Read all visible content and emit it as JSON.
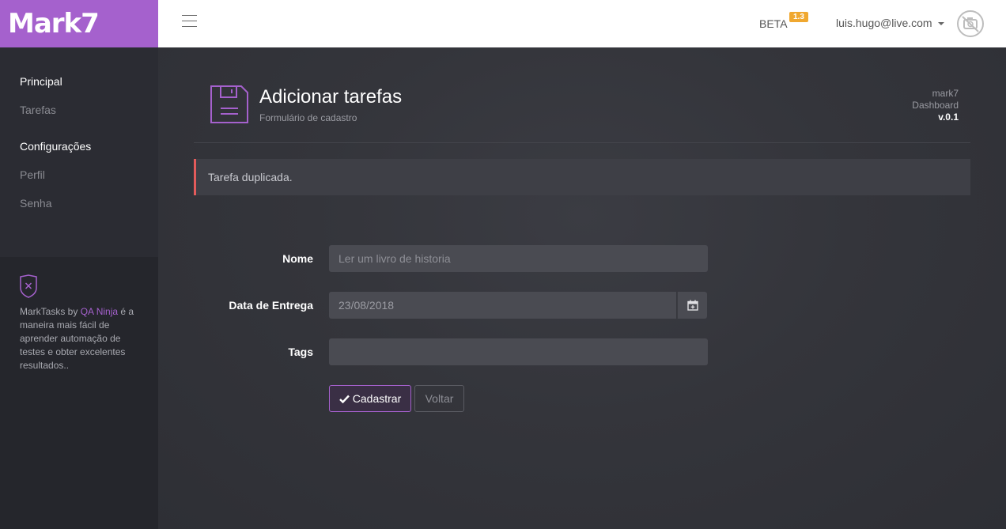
{
  "brand": {
    "name": "Mark7"
  },
  "header": {
    "beta_label": "BETA",
    "beta_version": "1.3",
    "user_email": "luis.hugo@live.com"
  },
  "sidebar": {
    "sections": [
      {
        "heading": "Principal",
        "items": [
          "Tarefas"
        ]
      },
      {
        "heading": "Configurações",
        "items": [
          "Perfil",
          "Senha"
        ]
      }
    ],
    "footer": {
      "text_before": "MarkTasks by ",
      "link": "QA Ninja",
      "text_after": " é a maneira mais fácil de aprender automação de testes e obter excelentes resultados.."
    }
  },
  "page": {
    "title": "Adicionar tarefas",
    "subtitle": "Formulário de cadastro",
    "meta": {
      "app": "mark7",
      "section": "Dashboard",
      "version": "v.0.1"
    }
  },
  "alert": {
    "message": "Tarefa duplicada."
  },
  "form": {
    "nome_label": "Nome",
    "nome_placeholder": "Ler um livro de historia",
    "data_label": "Data de Entrega",
    "data_value": "23/08/2018",
    "tags_label": "Tags",
    "tags_value": "",
    "submit_label": "Cadastrar",
    "back_label": "Voltar"
  },
  "colors": {
    "accent": "#a561cd",
    "alert_border": "#e35b5b",
    "badge": "#f0a830"
  }
}
